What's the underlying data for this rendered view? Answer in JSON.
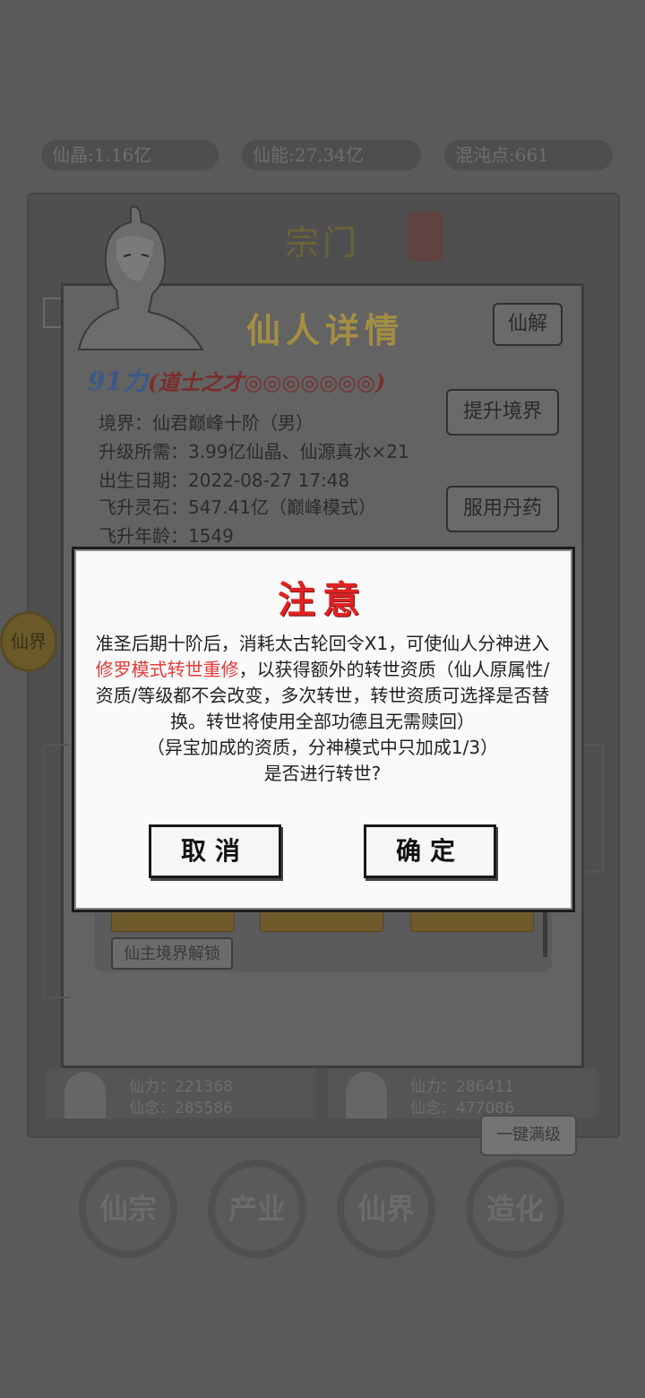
{
  "resources": {
    "xianjing": "仙晶:1.16亿",
    "xianneng": "仙能:27.34亿",
    "hundun": "混沌点:661"
  },
  "sect": {
    "title": "宗门"
  },
  "side_badge": {
    "label": "仙界"
  },
  "detail": {
    "title": "仙人详情",
    "btn_xianjie": "仙解",
    "btn_upgrade": "提升境界",
    "btn_pill": "服用丹药",
    "power_num": "91力",
    "power_tag": "(道士之才◎◎◎◎◎◎◎)",
    "realm": "境界：仙君巅峰十阶（男）",
    "upgrade_cost": "升级所需：3.99亿仙晶、仙源真水×21",
    "birth": "出生日期：2022-08-27 17:48",
    "ascend_stone": "飞升灵石：547.41亿（巅峰模式）",
    "ascend_age": "飞升年龄：1549",
    "unlock_tag": "仙主境界解锁"
  },
  "members": [
    {
      "power": "仙力：221368",
      "thought": "仙念：285586"
    },
    {
      "power": "仙力：286411",
      "thought": "仙念：477086"
    }
  ],
  "onekey_label": "一键满级",
  "nav": {
    "xianzong": "仙宗",
    "chanye": "产业",
    "xianjie": "仙界",
    "zaohua": "造化"
  },
  "modal": {
    "title": "注意",
    "msg_pre": "准圣后期十阶后，消耗太古轮回令X1，可使仙人分神进入",
    "msg_highlight": "修罗模式转世重修",
    "msg_post": "，以获得额外的转世资质（仙人原属性/资质/等级都不会改变，多次转世，转世资质可选择是否替换。转世将使用全部功德且无需赎回）",
    "msg_note": "（异宝加成的资质，分神模式中只加成1/3）",
    "msg_question": "是否进行转世?",
    "cancel": "取消",
    "confirm": "确定"
  }
}
